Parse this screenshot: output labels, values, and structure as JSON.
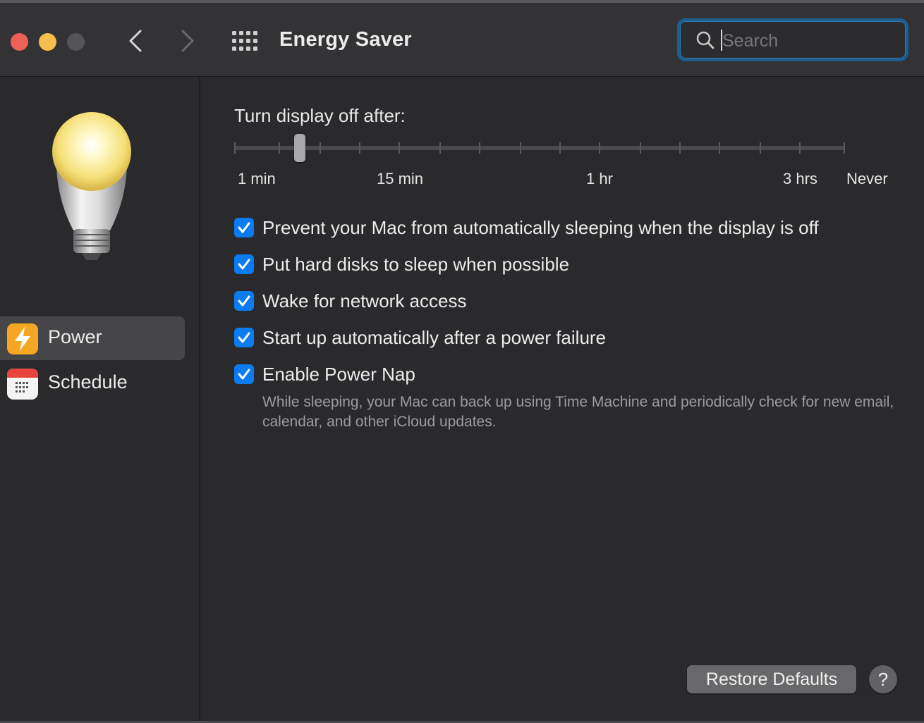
{
  "window": {
    "title": "Energy Saver"
  },
  "toolbar": {
    "back_icon": "chevron-left-icon",
    "forward_icon": "chevron-right-icon",
    "show_all_icon": "grid-icon"
  },
  "search": {
    "placeholder": "Search",
    "value": ""
  },
  "sidebar": {
    "items": [
      {
        "label": "Power",
        "icon": "lightning-bolt-icon",
        "selected": true
      },
      {
        "label": "Schedule",
        "icon": "calendar-icon",
        "selected": false
      }
    ]
  },
  "display_sleep": {
    "title": "Turn display off after:",
    "labels": [
      "1 min",
      "15 min",
      "1 hr",
      "3 hrs",
      "Never"
    ],
    "current_value": "2 min"
  },
  "options": [
    {
      "label": "Prevent your Mac from automatically sleeping when the display is off",
      "checked": true
    },
    {
      "label": "Put hard disks to sleep when possible",
      "checked": true
    },
    {
      "label": "Wake for network access",
      "checked": true
    },
    {
      "label": "Start up automatically after a power failure",
      "checked": true
    },
    {
      "label": "Enable Power Nap",
      "checked": true
    }
  ],
  "power_nap_description": "While sleeping, your Mac can back up using Time Machine and periodically check for new email, calendar, and other iCloud updates.",
  "footer": {
    "restore_label": "Restore Defaults",
    "help_label": "?"
  },
  "colors": {
    "accent": "#0a7bf0",
    "close": "#ed5f57",
    "minimize": "#f6be4f",
    "power_icon": "#f5a623"
  }
}
